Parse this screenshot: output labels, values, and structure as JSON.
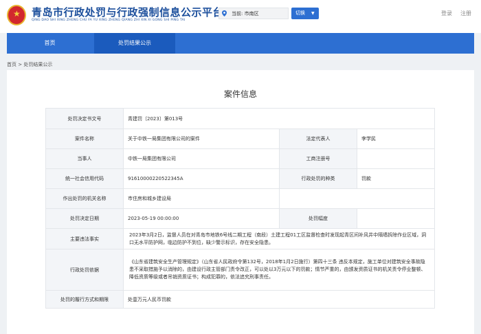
{
  "header": {
    "title": "青岛市行政处罚与行政强制信息公示平台",
    "subtitle": "QING DAO SHI XING ZHENG CHU FA YU XING ZHENG QIANG ZHI XIN XI GONG SHI PING TAI",
    "location": "当前: 市南区",
    "switch_label": "切换",
    "login": "登录",
    "register": "注册"
  },
  "nav": {
    "home": "首页",
    "results": "处罚结果公示"
  },
  "breadcrumb": {
    "home": "首页",
    "sep": ">",
    "current": "处罚结果公示"
  },
  "panel": {
    "title": "案件信息"
  },
  "case": {
    "doc_no_label": "处罚决定书文号",
    "doc_no": "青建罚〔2023〕第013号",
    "case_name_label": "案件名称",
    "case_name": "关于中铁一局集团有限公司的案件",
    "legal_rep_label": "法定代表人",
    "legal_rep": "李学民",
    "party_label": "当事人",
    "party": "中铁一局集团有限公司",
    "reg_no_label": "工商注册号",
    "reg_no": "",
    "credit_code_label": "统一社会信用代码",
    "credit_code": "91610000220522345A",
    "penalty_type_label": "行政处罚的种类",
    "penalty_type": "罚款",
    "authority_label": "作出处罚的机关名称",
    "authority": "市住房和城乡建设局",
    "date_label": "处罚决定日期",
    "date": "2023-05-19 00:00:00",
    "amount_label": "处罚幅度",
    "amount": "",
    "facts_label": "主要违法事实",
    "facts": "2023年3月2日，监督人员在对青岛市地铁6号线二期工程（南段）土建工程01工区监督检查时发现起青区间补风井中隔墙拆除作业区域，洞口无水平防护网，临边防护不到位，缺少警示标识，存在安全隐患。",
    "basis_label": "行政处罚依据",
    "basis": "《山东省建筑安全生产管理规定》（山东省人民政府令第132号，2018年1月2日施行）第四十三条 违反本规定，施工单位对建筑安全事故隐患不采取措施予以消除的，由建设行政主管部门责令改正，可以处以3万元以下的罚款；情节严重的，由颁发资质证书的机关责令停业整顿、降低资质等级或者吊销资质证书；构成犯罪的，依法追究刑事责任。",
    "result_label": "处罚的履行方式和期限",
    "result": "处壹万元人民币罚款"
  }
}
